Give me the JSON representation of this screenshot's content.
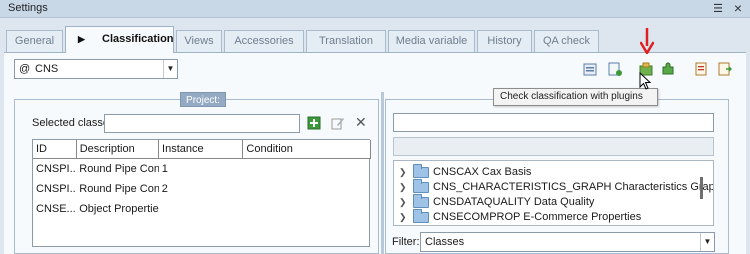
{
  "window": {
    "title": "Settings"
  },
  "tabs": [
    "General",
    "Classification",
    "Views",
    "Accessories",
    "Translation",
    "Media variable",
    "History",
    "QA check"
  ],
  "active_tab": "Classification",
  "classification_combo": {
    "prefix": "@",
    "value": "CNS"
  },
  "toolbar_icons": [
    "export-icon",
    "add-document-icon",
    "check-plugins-icon",
    "puzzle-icon",
    "edit-list-icon",
    "export-list-icon"
  ],
  "tooltip": "Check classification with plugins",
  "project": {
    "label": "Project:",
    "selected_classes_label": "Selected classes",
    "selected_classes_value": "",
    "columns": [
      "ID",
      "Description",
      "Instance",
      "Condition"
    ],
    "rows": [
      {
        "id": "CNSPI...",
        "description": "Round Pipe Con...",
        "instance": "1",
        "condition": ""
      },
      {
        "id": "CNSPI...",
        "description": "Round Pipe Con...",
        "instance": "2",
        "condition": ""
      },
      {
        "id": "CNSE...",
        "description": "Object Properties",
        "instance": "",
        "condition": ""
      }
    ]
  },
  "classes_tree": [
    "CNSCAX Cax Basis",
    "CNS_CHARACTERISTICS_GRAPH Characteristics Graph",
    "CNSDATAQUALITY Data Quality",
    "CNSECOMPROP E-Commerce Properties"
  ],
  "filter": {
    "label": "Filter:",
    "value": "Classes"
  },
  "colors": {
    "accent": "#94aac3",
    "arrow": "#e02020",
    "folder": "#9ec3e6",
    "add_green": "#3a9a3a"
  }
}
